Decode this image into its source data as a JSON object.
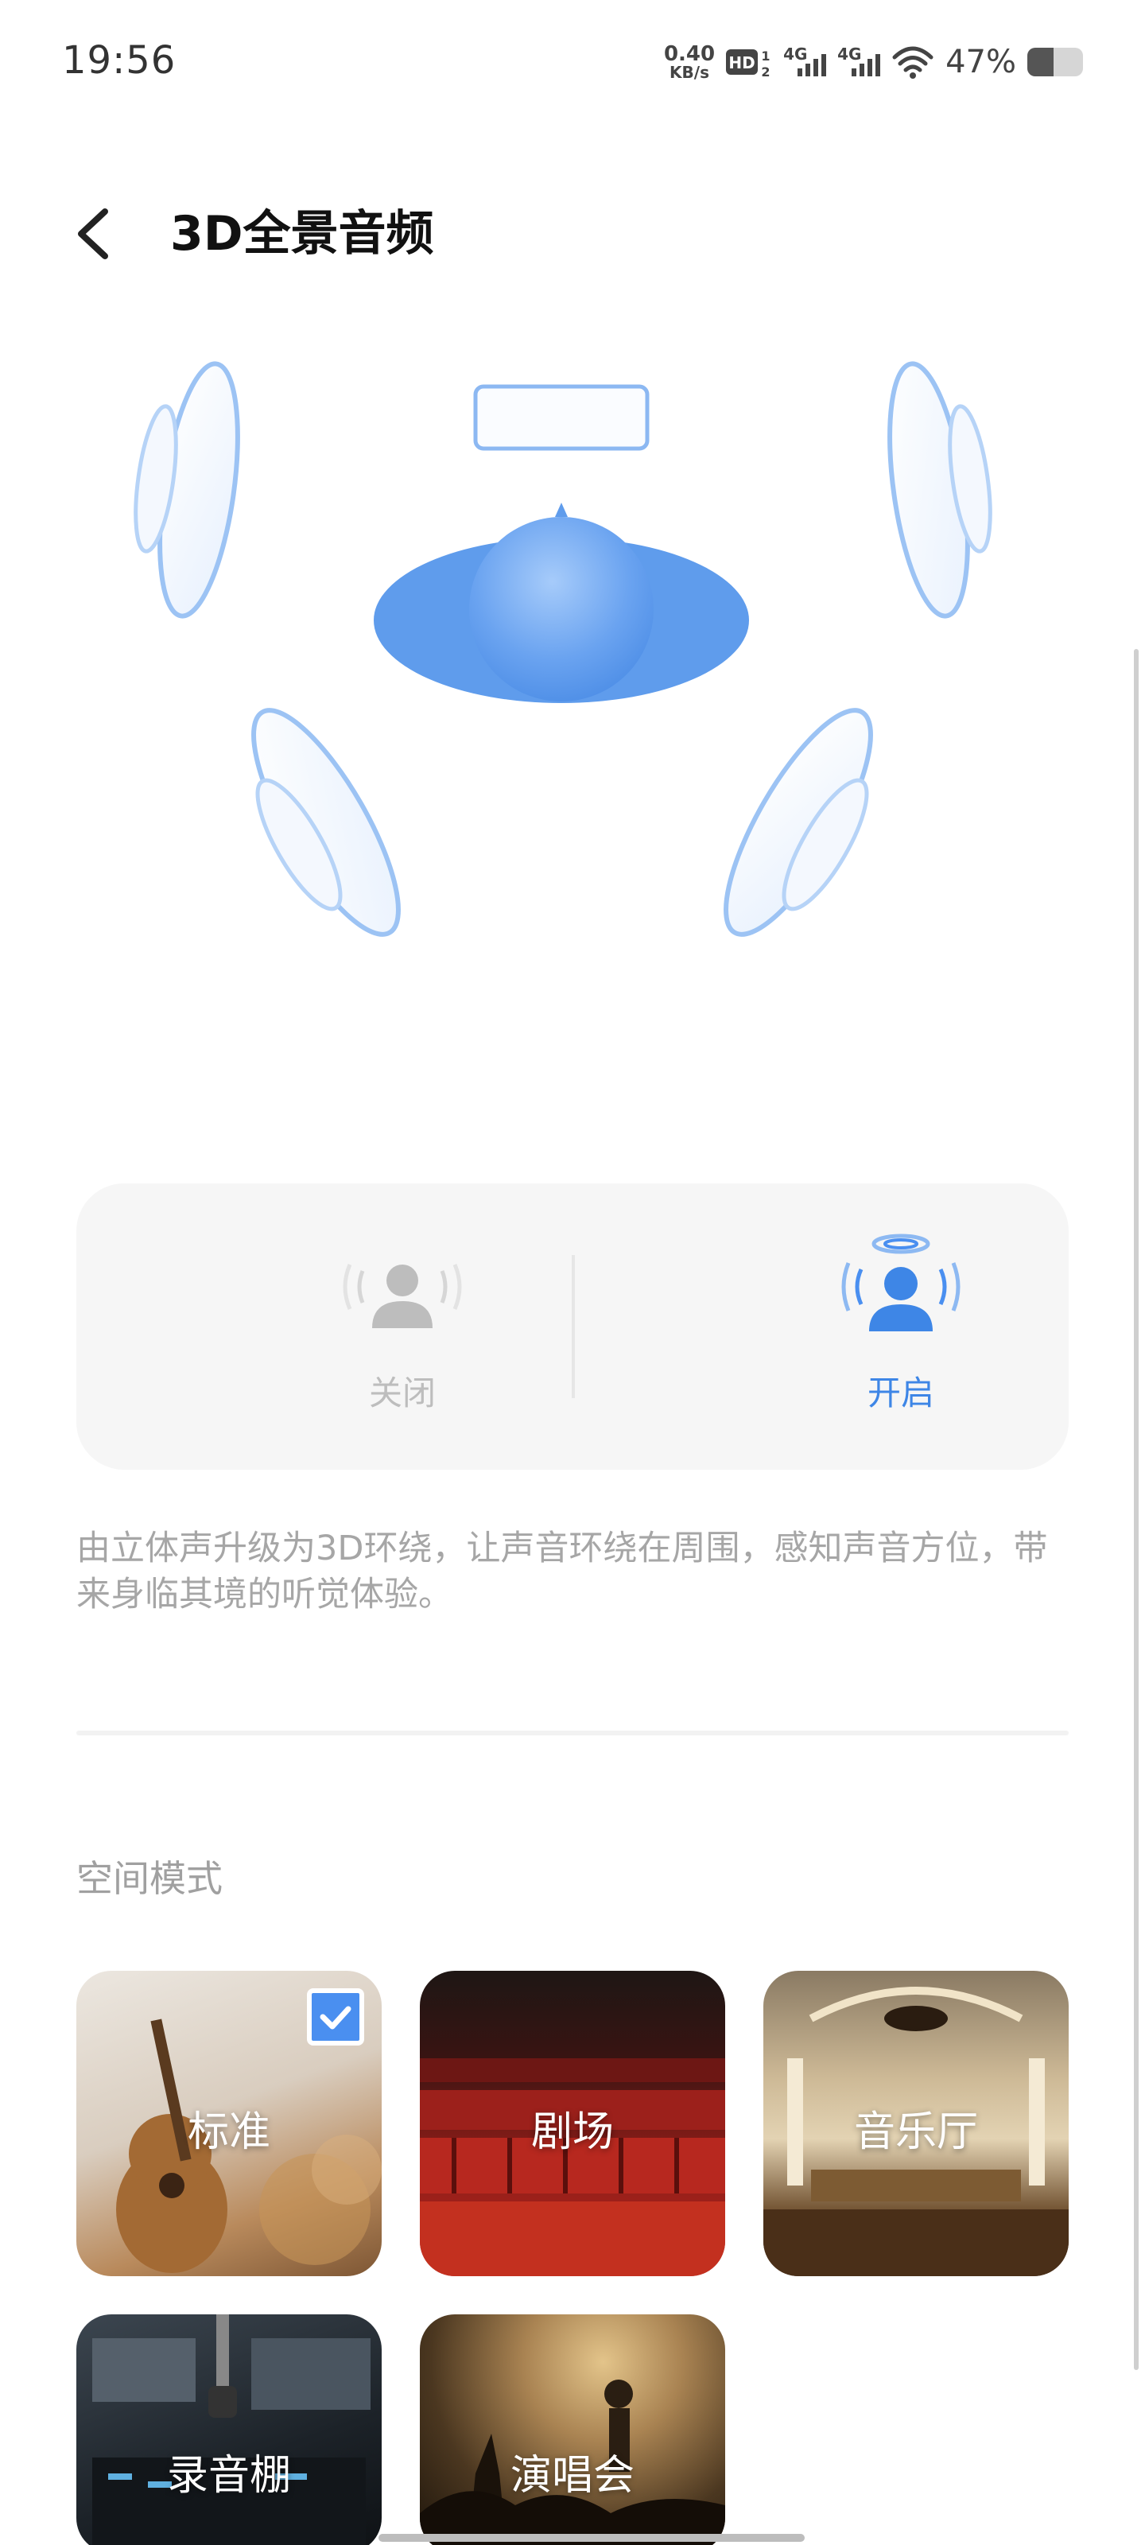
{
  "status_bar": {
    "time": "19:56",
    "net_speed_value": "0.40",
    "net_speed_unit": "KB/s",
    "hd_label": "HD",
    "sim1_label": "4G",
    "sim2_label": "4G",
    "battery_percent": "47%",
    "battery_level": 0.47
  },
  "header": {
    "title": "3D全景音频"
  },
  "toggle": {
    "off_label": "关闭",
    "on_label": "开启",
    "selected": "on",
    "accent_color": "#3e86e6",
    "inactive_color": "#bdbdbd"
  },
  "description": "由立体声升级为3D环绕，让声音环绕在周围，感知声音方位，带来身临其境的听觉体验。",
  "spatial_modes": {
    "title": "空间模式",
    "items": [
      {
        "label": "标准",
        "selected": true
      },
      {
        "label": "剧场",
        "selected": false
      },
      {
        "label": "音乐厅",
        "selected": false
      },
      {
        "label": "录音棚",
        "selected": false
      },
      {
        "label": "演唱会",
        "selected": false
      }
    ]
  }
}
